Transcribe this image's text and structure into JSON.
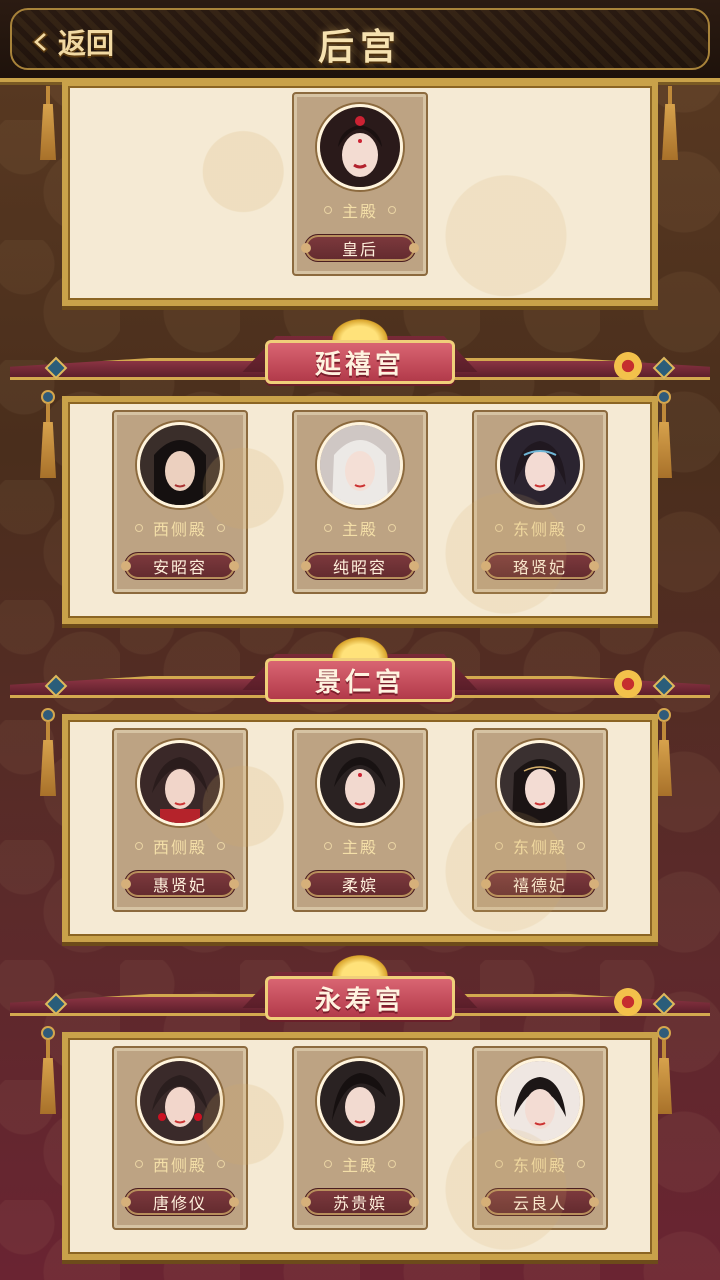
{
  "header": {
    "back_label": "返回",
    "title": "后宫"
  },
  "palaces": [
    {
      "name": "",
      "consorts": [
        {
          "hall": "主殿",
          "name": "皇后",
          "avatar": "empress-portrait"
        }
      ]
    },
    {
      "name": "延禧宫",
      "consorts": [
        {
          "hall": "西侧殿",
          "name": "安昭容",
          "avatar": "consort-portrait-black-hair"
        },
        {
          "hall": "主殿",
          "name": "纯昭容",
          "avatar": "consort-portrait-white-hair"
        },
        {
          "hall": "东侧殿",
          "name": "珞贤妃",
          "avatar": "consort-portrait-blue-ornaments"
        }
      ]
    },
    {
      "name": "景仁宫",
      "consorts": [
        {
          "hall": "西侧殿",
          "name": "惠贤妃",
          "avatar": "consort-portrait-red-collar"
        },
        {
          "hall": "主殿",
          "name": "柔嫔",
          "avatar": "consort-portrait-forehead-mark"
        },
        {
          "hall": "东侧殿",
          "name": "禧德妃",
          "avatar": "consort-portrait-headband"
        }
      ]
    },
    {
      "name": "永寿宫",
      "consorts": [
        {
          "hall": "西侧殿",
          "name": "唐修仪",
          "avatar": "consort-portrait-red-earrings"
        },
        {
          "hall": "主殿",
          "name": "苏贵嫔",
          "avatar": "consort-portrait-side-bang"
        },
        {
          "hall": "东侧殿",
          "name": "云良人",
          "avatar": "consort-portrait-short-hair"
        }
      ]
    }
  ],
  "colors": {
    "gold": "#c9a24a",
    "crimson": "#b23a4a",
    "parchment": "#f5ead4",
    "card": "#bda383"
  }
}
